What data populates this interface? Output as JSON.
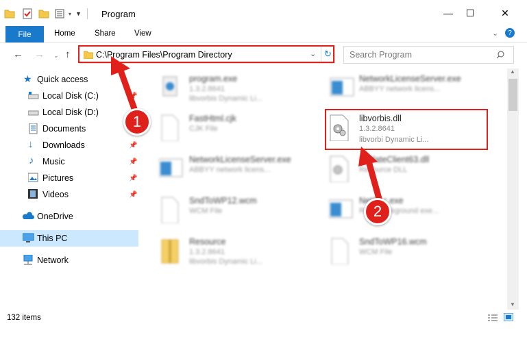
{
  "window": {
    "title": "Program",
    "minimize_glyph": "—",
    "maximize_glyph": "☐",
    "close_glyph": "✕"
  },
  "ribbon": {
    "file_tab": "File",
    "tabs": [
      "Home",
      "Share",
      "View"
    ]
  },
  "address_bar": {
    "path": "C:\\Program Files\\Program Directory",
    "search_placeholder": "Search Program"
  },
  "sidebar": {
    "items": [
      {
        "label": "Quick access",
        "icon": "star-icon"
      },
      {
        "label": "Local Disk (C:)",
        "icon": "drive-icon",
        "pinned": true
      },
      {
        "label": "Local Disk (D:)",
        "icon": "drive-icon",
        "pinned": true
      },
      {
        "label": "Documents",
        "icon": "documents-icon",
        "pinned": true
      },
      {
        "label": "Downloads",
        "icon": "download-arrow-icon",
        "pinned": true
      },
      {
        "label": "Music",
        "icon": "music-note-icon",
        "pinned": true
      },
      {
        "label": "Pictures",
        "icon": "pictures-icon",
        "pinned": true
      },
      {
        "label": "Videos",
        "icon": "film-icon",
        "pinned": true
      },
      {
        "label": "OneDrive",
        "icon": "cloud-icon"
      },
      {
        "label": "This PC",
        "icon": "computer-icon",
        "selected": true
      },
      {
        "label": "Network",
        "icon": "network-icon"
      }
    ]
  },
  "files": [
    {
      "name": "program.exe",
      "line2": "1.3.2.8641",
      "line3": "libvorbis Dynamic Li...",
      "icon": "exe-icon",
      "blurred": true
    },
    {
      "name": "NetworkLicenseServer.exe",
      "line2": "ABBYY network licens...",
      "line3": "",
      "icon": "window-app-icon",
      "blurred": true
    },
    {
      "name": "FastHtml.cjk",
      "line2": "CJK File",
      "line3": "",
      "icon": "blank-file-icon",
      "blurred": true
    },
    {
      "name": "libvorbis.dll",
      "line2": "1.3.2.8641",
      "line3": "libvorbi Dynamic Li...",
      "icon": "dll-gear-icon",
      "blurred": false
    },
    {
      "name": "NetworkLicenseServer.exe",
      "line2": "ABBYY network licens...",
      "line3": "",
      "icon": "window-app-icon",
      "blurred": true
    },
    {
      "name": "UpdateClient63.dll",
      "line2": "Resource DLL",
      "line3": "",
      "icon": "dll-gear-icon",
      "blurred": true
    },
    {
      "name": "SndToWP12.wcm",
      "line2": "WCM File",
      "line3": "",
      "icon": "blank-file-icon",
      "blurred": true
    },
    {
      "name": "NetSec.exe",
      "line2": "Runs background exe...",
      "line3": "",
      "icon": "window-app-icon",
      "blurred": true
    },
    {
      "name": "Resource",
      "line2": "1.3.2.8641",
      "line3": "libvorbis Dynamic Li...",
      "icon": "archive-icon",
      "blurred": true
    },
    {
      "name": "SndToWP16.wcm",
      "line2": "WCM File",
      "line3": "",
      "icon": "blank-file-icon",
      "blurred": true
    }
  ],
  "status": {
    "item_count": "132 items"
  },
  "callouts": [
    "1",
    "2"
  ],
  "colors": {
    "accent": "#1979ca",
    "highlight_red": "#e0201b",
    "selected_bg": "#cce8ff"
  }
}
